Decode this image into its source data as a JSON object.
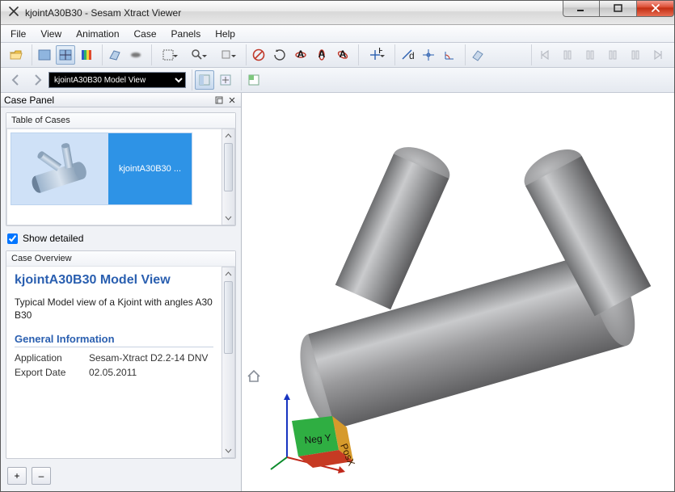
{
  "window": {
    "title": "kjointA30B30 - Sesam Xtract Viewer",
    "buttons": {
      "min": "Minimize",
      "max": "Maximize",
      "close": "Close"
    }
  },
  "menu": {
    "file": "File",
    "view": "View",
    "animation": "Animation",
    "case": "Case",
    "panels": "Panels",
    "help": "Help"
  },
  "nav": {
    "history_selected": "kjointA30B30 Model View"
  },
  "casepanel": {
    "title": "Case Panel",
    "table_title": "Table of Cases",
    "case_label": "kjointA30B30 ...",
    "show_detailed": "Show detailed",
    "overview_title": "Case Overview",
    "ov_heading": "kjointA30B30 Model View",
    "ov_description": "Typical Model view of a Kjoint with angles A30 B30",
    "gi_heading": "General Information",
    "rows": {
      "application_k": "Application",
      "application_v": "Sesam-Xtract D2.2-14 DNV",
      "exportdate_k": "Export Date",
      "exportdate_v": "02.05.2011"
    },
    "plus": "+",
    "minus": "–"
  },
  "triad": {
    "negy": "Neg Y",
    "posx": "PosX"
  }
}
